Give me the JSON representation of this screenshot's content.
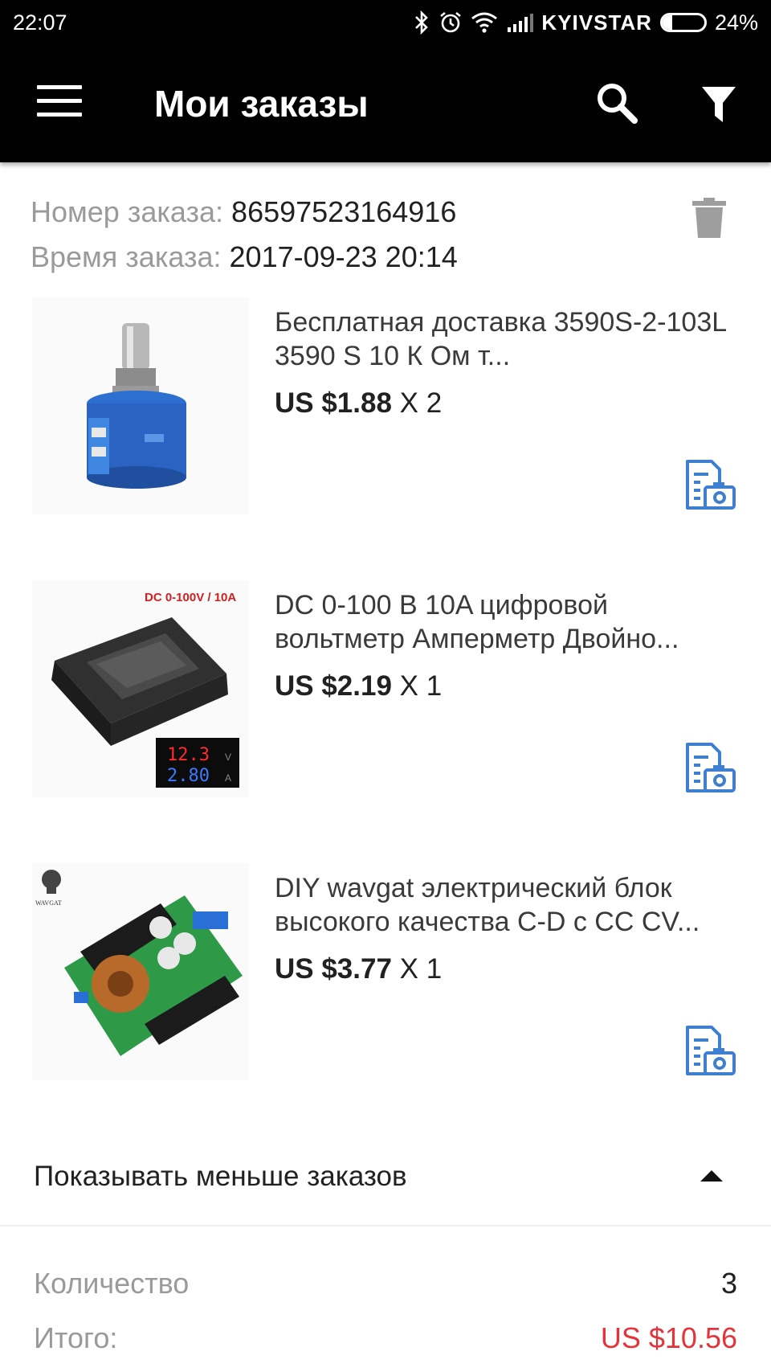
{
  "status_bar": {
    "time": "22:07",
    "carrier": "KYIVSTAR",
    "battery_text": "24%",
    "battery_level": 0.24,
    "icons": [
      "bluetooth-icon",
      "alarm-icon",
      "wifi-icon",
      "signal-icon",
      "battery-icon"
    ]
  },
  "toolbar": {
    "title": "Мои заказы",
    "icons": [
      "menu-icon",
      "search-icon",
      "filter-icon"
    ]
  },
  "order": {
    "number_label": "Номер заказа:",
    "number": "86597523164916",
    "time_label": "Время заказа:",
    "time": "2017-09-23 20:14",
    "delete_icon": "trash-icon"
  },
  "items": [
    {
      "title": "Бесплатная доставка 3590S-2-103L 3590 S 10 К Ом т...",
      "price": "US $1.88",
      "qty": "X 2",
      "image": "potentiometer"
    },
    {
      "title": "DC 0-100 В 10A цифровой вольтметр Амперметр Двойно...",
      "price": "US $2.19",
      "qty": "X 1",
      "image": "voltmeter",
      "image_caption": "DC 0-100V / 10A",
      "display_top": "12.3",
      "display_bottom": "2.80",
      "display_top_unit": "V",
      "display_bottom_unit": "A"
    },
    {
      "title": "DIY wavgat электрический блок высокого качества C-D с CC CV...",
      "price": "US $3.77",
      "qty": "X 1",
      "image": "converter-board",
      "brand": "WAVGAT"
    }
  ],
  "toggle": {
    "label": "Показывать меньше заказов"
  },
  "summary": {
    "qty_label": "Количество",
    "qty_value": "3",
    "total_label": "Итого:",
    "total_value": "US $10.56"
  },
  "colors": {
    "accent_blue": "#3f7fcf",
    "total_red": "#e5333b",
    "label_grey": "#9a9a9a"
  }
}
